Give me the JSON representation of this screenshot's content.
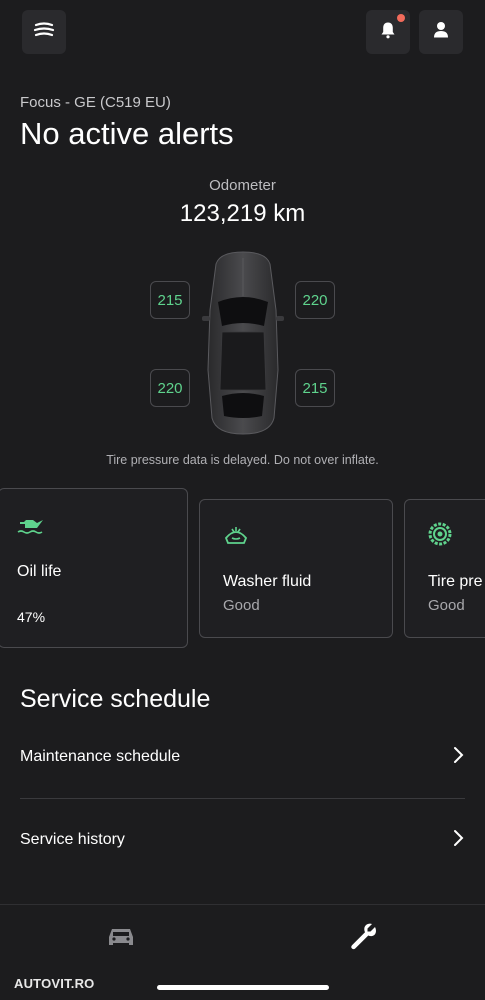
{
  "header": {
    "menu_icon": "fordpass-menu-icon",
    "notification_icon": "bell-icon",
    "profile_icon": "user-icon"
  },
  "vehicle": {
    "name": "Focus - GE (C519 EU)",
    "status": "No active alerts"
  },
  "odometer": {
    "label": "Odometer",
    "value": "123,219 km"
  },
  "tires": {
    "front_left": "215",
    "front_right": "220",
    "rear_left": "220",
    "rear_right": "215",
    "note": "Tire pressure data is delayed. Do not over inflate."
  },
  "cards": [
    {
      "label": "Oil life",
      "value": "47%",
      "icon": "oil-can-icon"
    },
    {
      "label": "Washer fluid",
      "value": "Good",
      "icon": "windshield-washer-icon"
    },
    {
      "label": "Tire pre",
      "value": "Good",
      "icon": "tire-icon"
    }
  ],
  "service": {
    "title": "Service schedule",
    "items": [
      {
        "label": "Maintenance schedule"
      },
      {
        "label": "Service history"
      }
    ]
  },
  "bottom_nav": {
    "items": [
      {
        "icon": "car-icon"
      },
      {
        "icon": "wrench-icon"
      }
    ]
  },
  "watermark": "AUTOVIT.RO",
  "colors": {
    "background": "#1c1c1e",
    "accent_green": "#5fd38d",
    "notification_dot": "#f26b5b",
    "card_border": "#4a4a4e"
  }
}
